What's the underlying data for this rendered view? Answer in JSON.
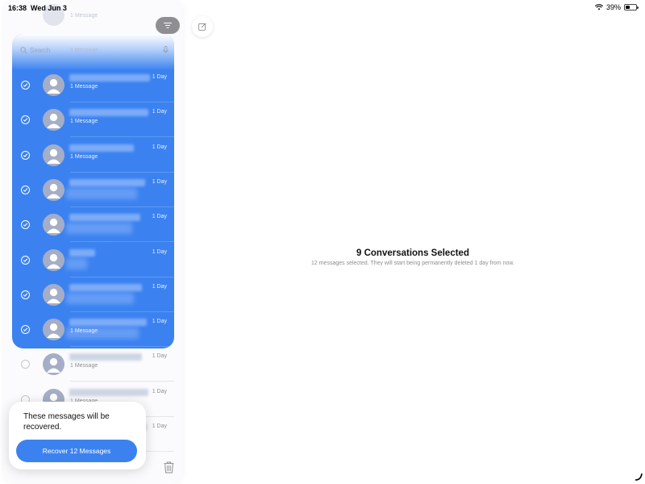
{
  "status": {
    "time": "16:38",
    "date": "Wed Jun 3",
    "battery": "39%",
    "battery_level": 0.39
  },
  "search": {
    "placeholder": "Search",
    "ghost_preview": "1 Message"
  },
  "ghost_row": {
    "preview": "1 Message"
  },
  "rows": [
    {
      "selected": true,
      "time": "1 Day",
      "preview": "1 Message"
    },
    {
      "selected": true,
      "time": "1 Day",
      "preview": "1 Message"
    },
    {
      "selected": true,
      "time": "1 Day",
      "preview": "1 Message"
    },
    {
      "selected": true,
      "time": "1 Day",
      "preview": ""
    },
    {
      "selected": true,
      "time": "1 Day",
      "preview": ""
    },
    {
      "selected": true,
      "time": "1 Day",
      "preview": ""
    },
    {
      "selected": true,
      "time": "1 Day",
      "preview": ""
    },
    {
      "selected": true,
      "time": "1 Day",
      "preview": "1 Message"
    },
    {
      "selected": false,
      "time": "1 Day",
      "preview": "1 Message"
    },
    {
      "selected": false,
      "time": "1 Day",
      "preview": "1 Message"
    },
    {
      "selected": false,
      "time": "1 Day",
      "preview": ""
    }
  ],
  "recover_bubble": {
    "message": "These messages will be recovered.",
    "button_label": "Recover 12 Messages"
  },
  "detail": {
    "title": "9 Conversations Selected",
    "subtitle": "12 messages selected. They will start being permanently deleted 1 day from now."
  },
  "icons": {
    "filter": "filter-lines-icon",
    "compose": "compose-icon",
    "search": "search-icon",
    "mic": "mic-icon",
    "check": "checkmark-icon",
    "trash": "trash-icon",
    "wifi": "wifi-icon",
    "battery": "battery-icon"
  },
  "colors": {
    "accent": "#3b82f0",
    "avatar": "#a5aec6",
    "secondary_text": "#8e8e93"
  }
}
